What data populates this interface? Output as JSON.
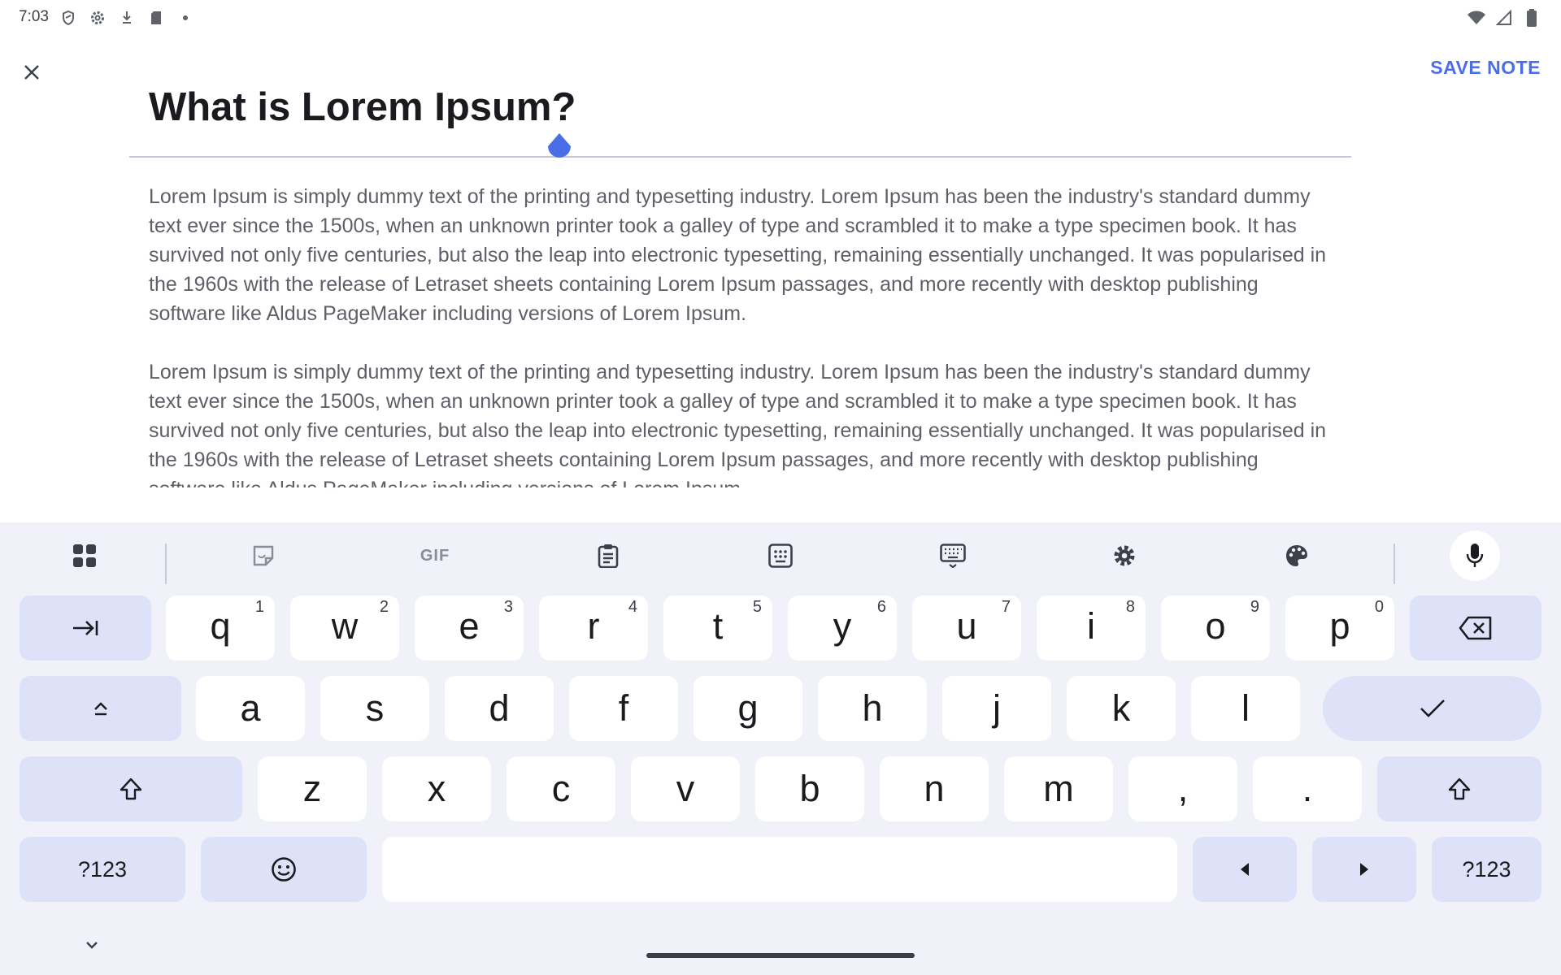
{
  "status_bar": {
    "time": "7:03",
    "left_icons": [
      "shield-icon",
      "gear-icon",
      "download-icon",
      "sd-card-icon",
      "dot-icon"
    ],
    "right_icons": [
      "wifi-icon",
      "cellular-icon",
      "battery-icon"
    ]
  },
  "header": {
    "close_icon": "close-icon",
    "save_label": "SAVE NOTE"
  },
  "note": {
    "title": "What is Lorem Ipsum?",
    "paragraphs": [
      "Lorem Ipsum is simply dummy text of the printing and typesetting industry. Lorem Ipsum has been the industry's standard dummy text ever since the 1500s, when an unknown printer took a galley of type and scrambled it to make a type specimen book. It has survived not only five centuries, but also the leap into electronic typesetting, remaining essentially unchanged. It was popularised in the 1960s with the release of Letraset sheets containing Lorem Ipsum passages, and more recently with desktop publishing software like Aldus PageMaker including versions of Lorem Ipsum.",
      "Lorem Ipsum is simply dummy text of the printing and typesetting industry. Lorem Ipsum has been the industry's standard dummy text ever since the 1500s, when an unknown printer took a galley of type and scrambled it to make a type specimen book. It has survived not only five centuries, but also the leap into electronic typesetting, remaining essentially unchanged. It was popularised in the 1960s with the release of Letraset sheets containing Lorem Ipsum passages, and more recently with desktop publishing software like Aldus PageMaker including versions of Lorem Ipsum."
    ]
  },
  "keyboard": {
    "toolbar": {
      "gif_label": "GIF",
      "icons": [
        "apps-grid-icon",
        "sticker-icon",
        "gif-icon",
        "clipboard-icon",
        "numpad-icon",
        "keyboard-icon",
        "gear-icon",
        "palette-icon",
        "microphone-icon"
      ]
    },
    "row1": [
      {
        "k": "q",
        "h": "1"
      },
      {
        "k": "w",
        "h": "2"
      },
      {
        "k": "e",
        "h": "3"
      },
      {
        "k": "r",
        "h": "4"
      },
      {
        "k": "t",
        "h": "5"
      },
      {
        "k": "y",
        "h": "6"
      },
      {
        "k": "u",
        "h": "7"
      },
      {
        "k": "i",
        "h": "8"
      },
      {
        "k": "o",
        "h": "9"
      },
      {
        "k": "p",
        "h": "0"
      }
    ],
    "row2": [
      "a",
      "s",
      "d",
      "f",
      "g",
      "h",
      "j",
      "k",
      "l"
    ],
    "row3": [
      "z",
      "x",
      "c",
      "v",
      "b",
      "n",
      "m",
      ",",
      "."
    ],
    "symbols_label": "?123",
    "symbols_label_right": "?123",
    "colors": {
      "key": "#ffffff",
      "modifier_key": "#dde2f8",
      "background": "#f0f1f9",
      "accent": "#4a6ee8"
    }
  }
}
